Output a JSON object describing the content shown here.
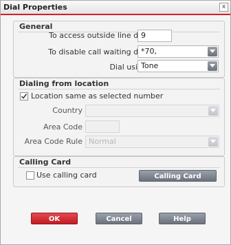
{
  "window": {
    "title": "Dial Properties",
    "close_glyph": "x"
  },
  "general": {
    "title": "General",
    "outside_line_label": "To access outside line dial",
    "outside_line_value": "9",
    "call_waiting_label": "To disable call waiting dial",
    "call_waiting_value": "*70,",
    "dial_using_label": "Dial using",
    "dial_using_value": "Tone"
  },
  "location": {
    "title": "Dialing from location",
    "same_as_selected_label": "Location same as selected number",
    "same_as_selected_checked": true,
    "country_label": "Country",
    "country_value": "",
    "area_code_label": "Area Code",
    "area_code_value": "",
    "area_code_rule_label": "Area Code Rule",
    "area_code_rule_value": "Normal"
  },
  "calling_card": {
    "title": "Calling Card",
    "use_label": "Use calling card",
    "use_checked": false,
    "button_label": "Calling Card"
  },
  "footer": {
    "ok_label": "OK",
    "cancel_label": "Cancel",
    "help_label": "Help"
  },
  "colors": {
    "accent": "#d41d2a",
    "button_gray": "#7d848e"
  }
}
